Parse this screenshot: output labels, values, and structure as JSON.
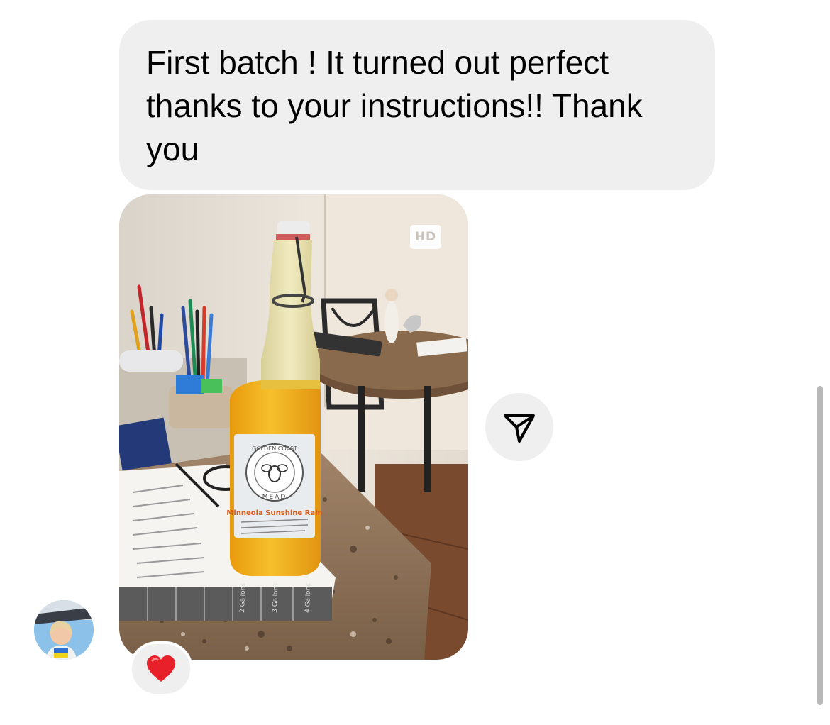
{
  "message": {
    "text": "First batch ! It turned out perfect thanks to your instructions!! Thank you"
  },
  "photo": {
    "hd_label": "HD",
    "label": {
      "brand": "GOLDEN COAST",
      "subbrand": "MEAD",
      "title": "Minneola Sunshine Rain"
    },
    "chart": {
      "cells": [
        "2 Gallons",
        "3 Gallons",
        "4 Gallons"
      ]
    }
  },
  "share": {
    "icon": "paper-plane-icon"
  },
  "avatar": {
    "icon": "user-avatar"
  },
  "reaction": {
    "icon": "red-heart-icon",
    "color": "#e8202a"
  },
  "colors": {
    "bubble": "#efefef",
    "background": "#ffffff",
    "heart": "#e8202a"
  }
}
